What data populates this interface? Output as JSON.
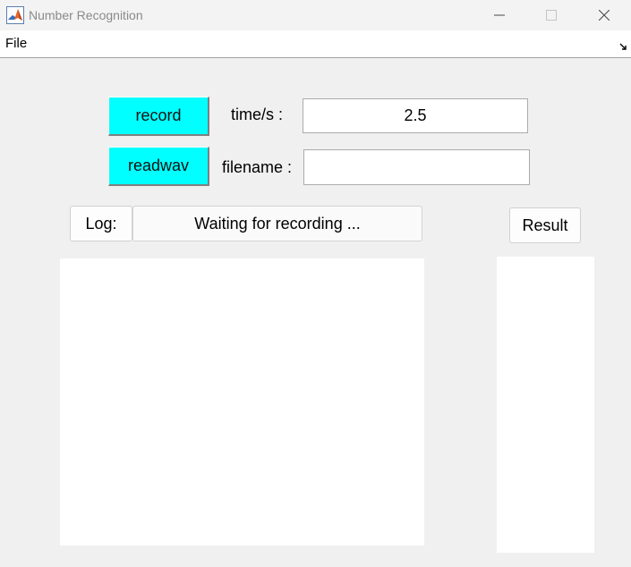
{
  "window": {
    "title": "Number Recognition",
    "icon": "matlab-icon",
    "controls": [
      "minimize-icon",
      "maximize-icon",
      "close-icon"
    ]
  },
  "menu": {
    "file_label": "File",
    "toolbar_toggle_icon": "toolbar-arrow-icon"
  },
  "controls": {
    "record_label": "record",
    "readwav_label": "readwav",
    "time_label": "time/s :",
    "time_value": "2.5",
    "filename_label": "filename :",
    "filename_value": "",
    "log_label": "Log:",
    "status_text": "Waiting for recording ...",
    "result_label": "Result"
  },
  "colors": {
    "button_accent": "#00ffff",
    "background": "#f0f0f0"
  }
}
